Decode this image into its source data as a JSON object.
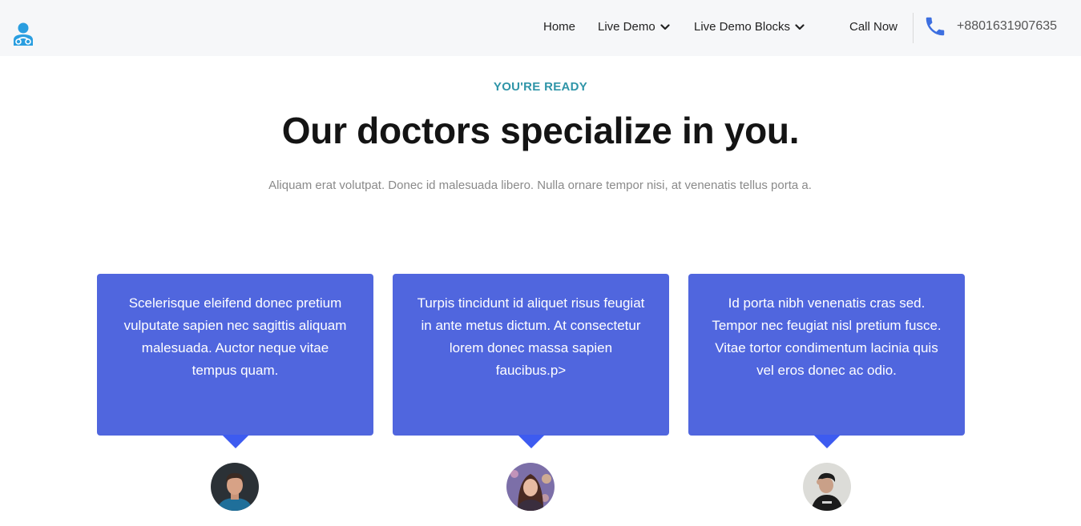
{
  "header": {
    "logo_icon": "doctor-stethoscope-icon",
    "nav": [
      {
        "label": "Home",
        "has_dropdown": false
      },
      {
        "label": "Live Demo",
        "has_dropdown": true
      },
      {
        "label": "Live Demo Blocks",
        "has_dropdown": true
      },
      {
        "label": "Call Now",
        "has_dropdown": false
      }
    ],
    "phone_icon": "phone-icon",
    "phone_number": "+8801631907635"
  },
  "hero": {
    "eyebrow": "YOU'RE READY",
    "title": "Our doctors specialize in you.",
    "subtitle": "Aliquam erat volutpat. Donec id malesuada libero. Nulla ornare tempor nisi, at venenatis tellus porta a."
  },
  "testimonials": [
    {
      "text": "Scelerisque eleifend donec pretium vulputate sapien nec sagittis aliquam malesuada. Auctor neque vitae tempus quam."
    },
    {
      "text": "Turpis tincidunt id aliquet risus feugiat in ante metus dictum. At consectetur lorem donec massa sapien faucibus.p>"
    },
    {
      "text": "Id porta nibh venenatis cras sed. Tempor nec feugiat nisl pretium fusce. Vitae tortor condimentum lacinia quis vel eros donec ac odio."
    }
  ],
  "colors": {
    "header_bg": "#f6f7f9",
    "accent_teal": "#2f95a8",
    "card_bg": "#5066de",
    "pointer": "#3d5bf0",
    "phone_icon": "#3d6fe0"
  }
}
